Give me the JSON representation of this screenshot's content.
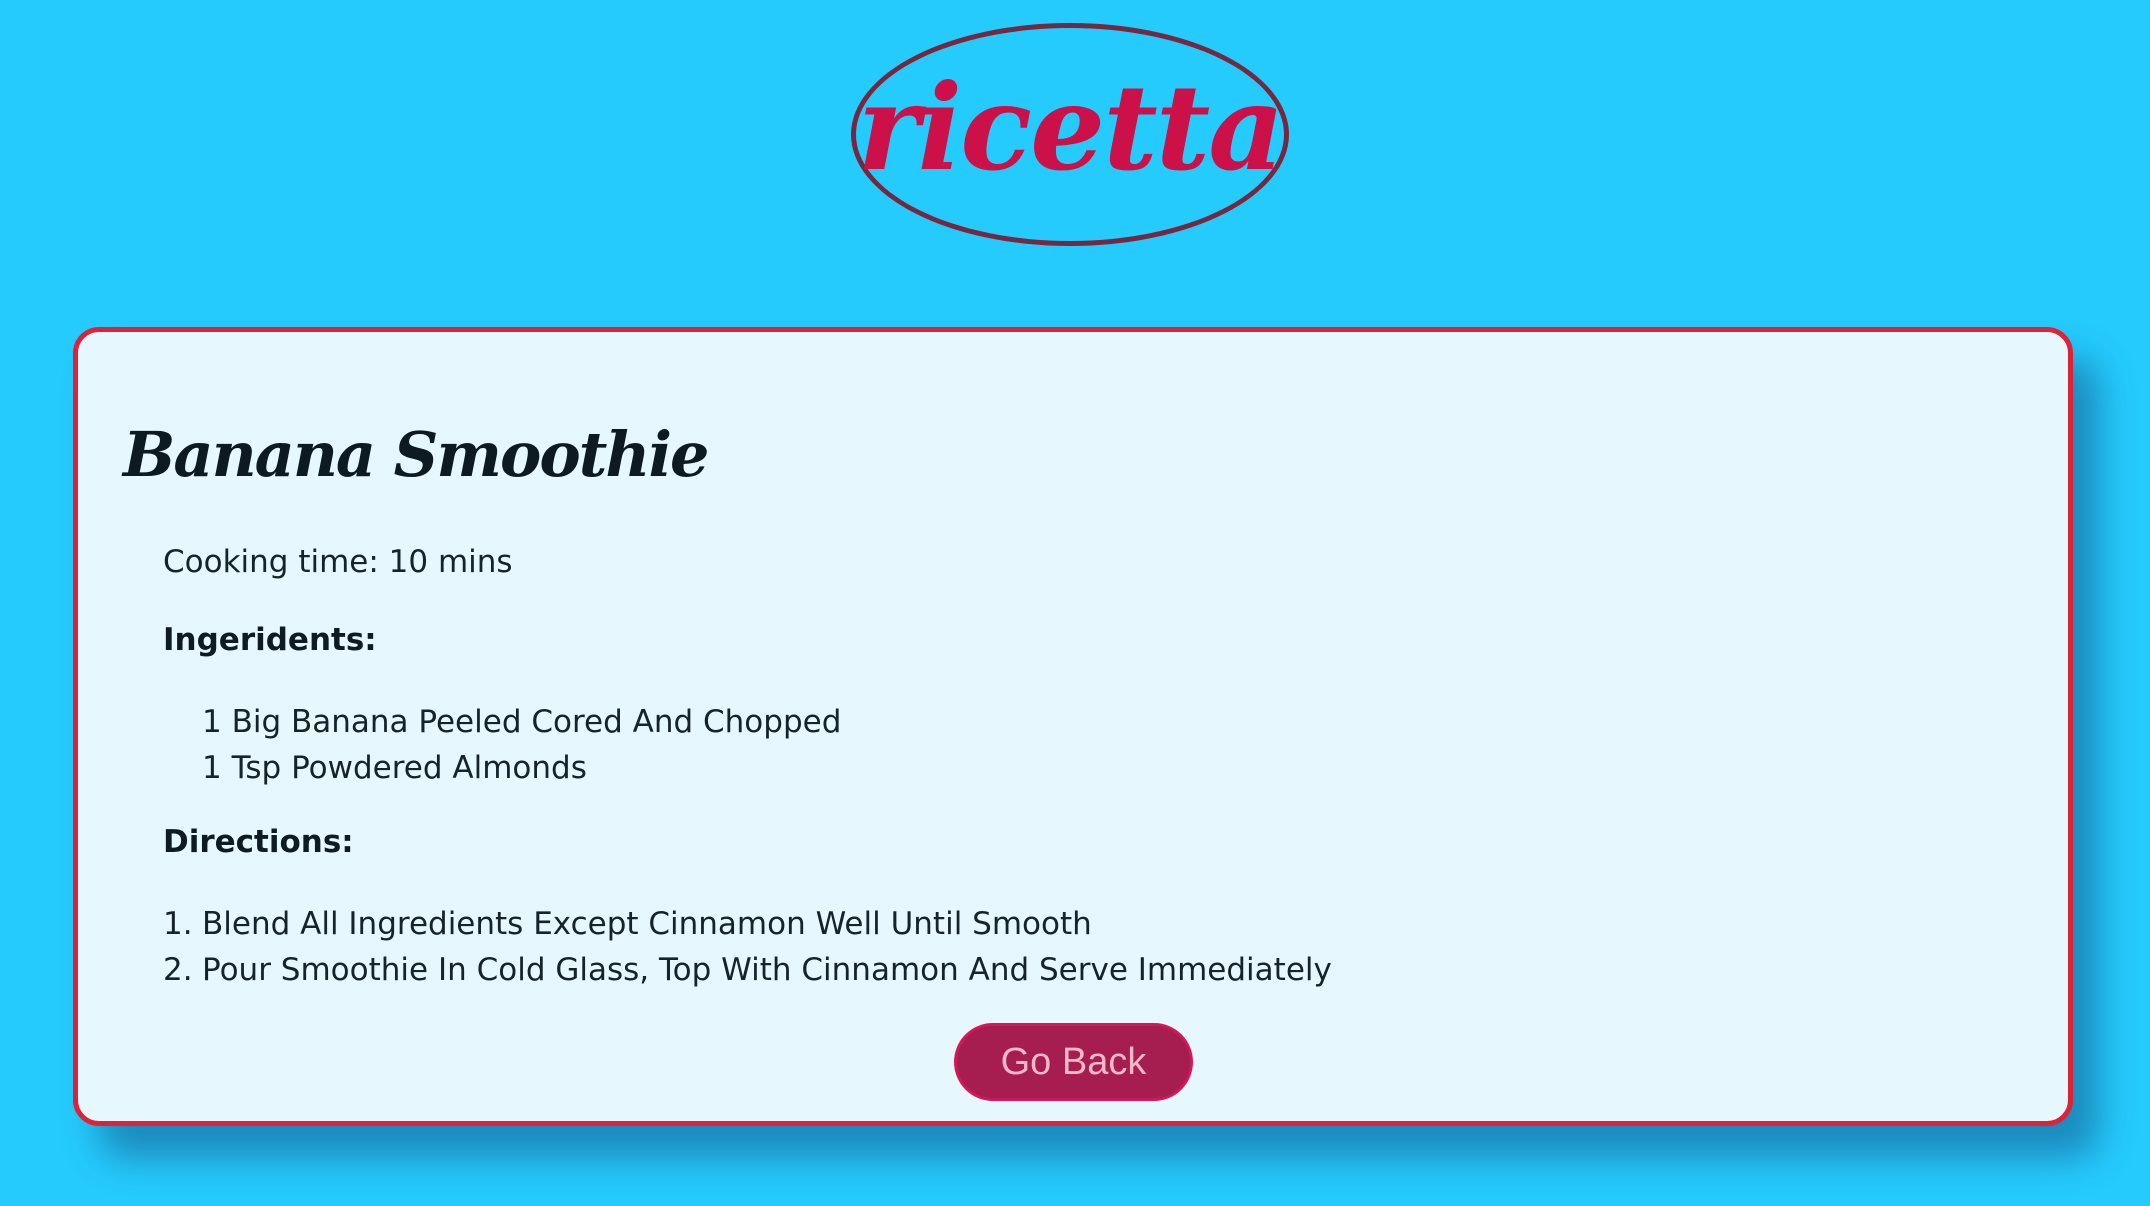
{
  "header": {
    "logo_text": "ricetta"
  },
  "recipe": {
    "title": "Banana Smoothie",
    "cooking_time_line": "Cooking time: 10 mins",
    "ingredients_heading": "Ingeridents:",
    "ingredients": [
      "1 Big Banana Peeled Cored And Chopped",
      "1 Tsp Powdered Almonds"
    ],
    "directions_heading": "Directions:",
    "directions": [
      {
        "number": "1.",
        "text": "Blend All Ingredients Except Cinnamon Well Until Smooth"
      },
      {
        "number": "2.",
        "text": "Pour Smoothie In Cold Glass, Top With Cinnamon And Serve Immediately"
      }
    ]
  },
  "actions": {
    "go_back_label": "Go Back"
  },
  "colors": {
    "page_background": "#25cbfd",
    "logo_text": "#cc1048",
    "logo_border": "#76283f",
    "card_background": "#e6f8fd",
    "card_border": "#de2237",
    "button_background": "#a51e4f",
    "button_text": "#f3b8c8"
  }
}
